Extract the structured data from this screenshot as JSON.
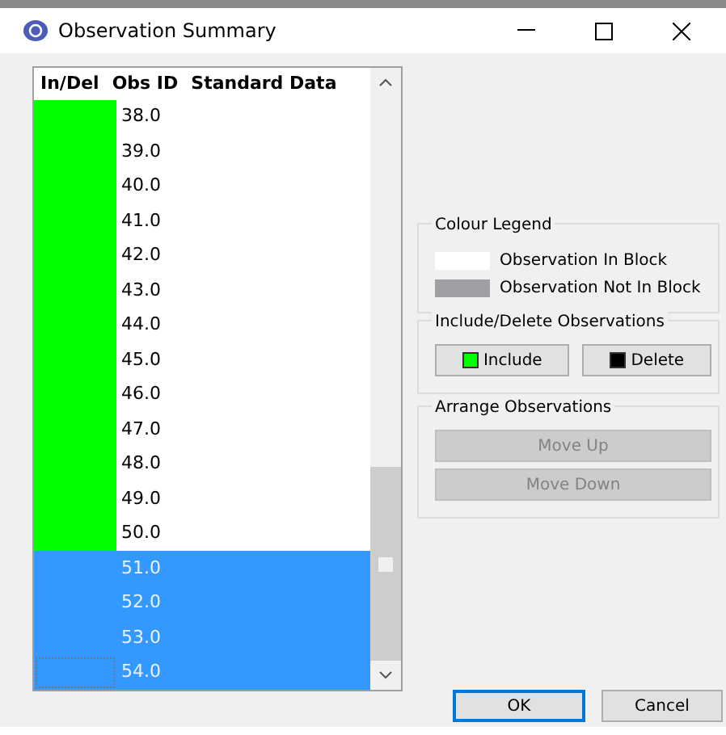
{
  "window": {
    "title": "Observation Summary"
  },
  "table": {
    "columns": [
      "In/Del",
      "Obs ID",
      "Standard Data"
    ],
    "rows": [
      {
        "obs_id": "38.0",
        "included": true,
        "selected": false,
        "focused": false
      },
      {
        "obs_id": "39.0",
        "included": true,
        "selected": false,
        "focused": false
      },
      {
        "obs_id": "40.0",
        "included": true,
        "selected": false,
        "focused": false
      },
      {
        "obs_id": "41.0",
        "included": true,
        "selected": false,
        "focused": false
      },
      {
        "obs_id": "42.0",
        "included": true,
        "selected": false,
        "focused": false
      },
      {
        "obs_id": "43.0",
        "included": true,
        "selected": false,
        "focused": false
      },
      {
        "obs_id": "44.0",
        "included": true,
        "selected": false,
        "focused": false
      },
      {
        "obs_id": "45.0",
        "included": true,
        "selected": false,
        "focused": false
      },
      {
        "obs_id": "46.0",
        "included": true,
        "selected": false,
        "focused": false
      },
      {
        "obs_id": "47.0",
        "included": true,
        "selected": false,
        "focused": false
      },
      {
        "obs_id": "48.0",
        "included": true,
        "selected": false,
        "focused": false
      },
      {
        "obs_id": "49.0",
        "included": true,
        "selected": false,
        "focused": false
      },
      {
        "obs_id": "50.0",
        "included": true,
        "selected": false,
        "focused": false
      },
      {
        "obs_id": "51.0",
        "selected": true,
        "focused": false
      },
      {
        "obs_id": "52.0",
        "selected": true,
        "focused": false
      },
      {
        "obs_id": "53.0",
        "selected": true,
        "focused": false
      },
      {
        "obs_id": "54.0",
        "selected": true,
        "focused": true
      }
    ]
  },
  "colour_legend": {
    "title": "Colour Legend",
    "items": [
      {
        "label": "Observation In Block",
        "color": "#ffffff"
      },
      {
        "label": "Observation Not In Block",
        "color": "#a0a0a4"
      }
    ]
  },
  "include_delete": {
    "title": "Include/Delete Observations",
    "buttons": [
      {
        "label": "Include",
        "color": "#00ff00"
      },
      {
        "label": "Delete",
        "color": "#000000"
      }
    ]
  },
  "arrange": {
    "title": "Arrange Observations",
    "buttons": [
      {
        "label": "Move Up",
        "disabled": true
      },
      {
        "label": "Move Down",
        "disabled": true
      }
    ]
  },
  "buttons": [
    {
      "label": "OK",
      "default": true
    },
    {
      "label": "Cancel",
      "default": false
    }
  ]
}
